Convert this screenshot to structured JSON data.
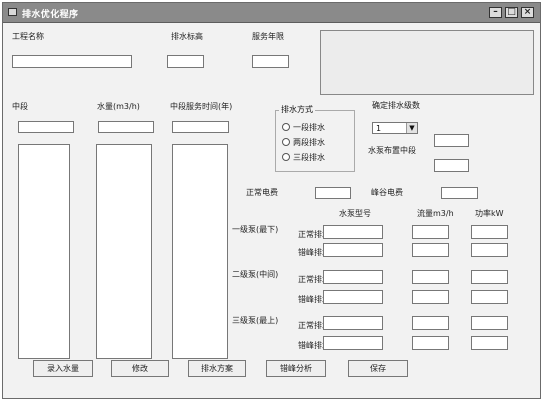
{
  "window": {
    "title": "排水优化程序"
  },
  "titlebar_buttons": {
    "minimize": "–",
    "maximize": "□",
    "close": "×"
  },
  "labels": {
    "project_name": "工程名称",
    "drainage_height": "排水标高",
    "service_years": "服务年限",
    "level": "中段",
    "water_volume": "水量(m3/h)",
    "level_service_time": "中段服务时间(年)",
    "drainage_mode": "排水方式",
    "confirm_stages": "确定排水级数",
    "pump_level": "水泵布置中段",
    "normal_electricity": "正常电费",
    "peak_electricity": "峰谷电费",
    "pump_model": "水泵型号",
    "flow": "流量m3/h",
    "power": "功率kW",
    "stage1": "一级泵(最下)",
    "stage2": "二级泵(中间)",
    "stage3": "三级泵(最上)",
    "normal_drain": "正常排水",
    "peak_drain": "错峰排水"
  },
  "radio_options": [
    "一段排水",
    "两段排水",
    "三段排水"
  ],
  "stages_select": {
    "value": "1"
  },
  "buttons": {
    "enter_water": "录入水量",
    "modify": "修改",
    "drain_plan": "排水方案",
    "peak_analysis": "错峰分析",
    "save": "保存"
  }
}
